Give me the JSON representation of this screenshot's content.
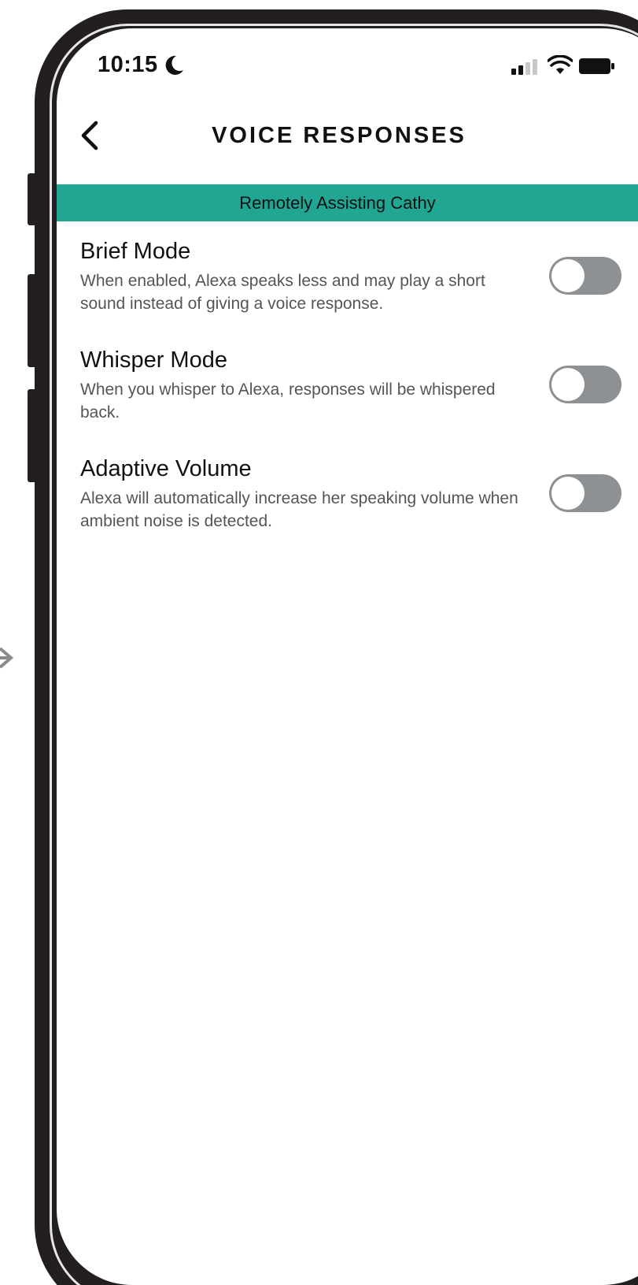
{
  "status_bar": {
    "time": "10:15"
  },
  "header": {
    "title": "VOICE RESPONSES"
  },
  "banner": {
    "text": "Remotely Assisting Cathy",
    "color": "#20a693"
  },
  "settings": [
    {
      "title": "Brief Mode",
      "description": "When enabled, Alexa speaks less and may play a short sound instead of giving a voice response.",
      "enabled": false
    },
    {
      "title": "Whisper Mode",
      "description": "When you whisper to Alexa, responses will be whispered back.",
      "enabled": false
    },
    {
      "title": "Adaptive Volume",
      "description": "Alexa will automatically increase her speaking volume when ambient noise is detected.",
      "enabled": false
    }
  ],
  "colors": {
    "toggle_off": "#8e9193",
    "frame": "#231f20"
  }
}
